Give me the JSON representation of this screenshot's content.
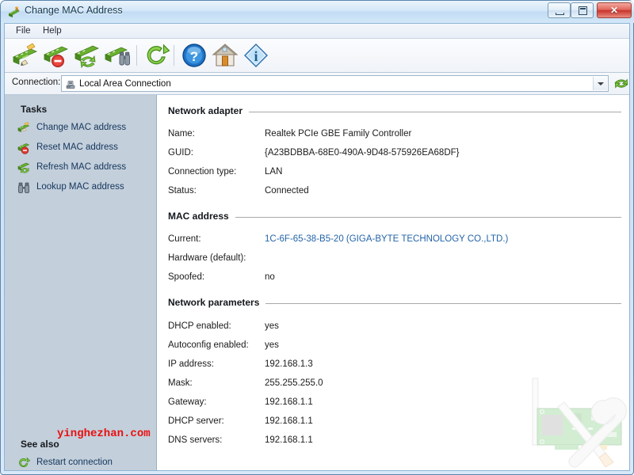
{
  "window": {
    "title": "Change MAC Address",
    "icon": "network-card-icon",
    "buttons": {
      "minimize": "minimize-button",
      "maximize": "maximize-button",
      "close_glyph": "✕"
    }
  },
  "menubar": {
    "items": [
      {
        "label": "File",
        "name": "menu-file"
      },
      {
        "label": "Help",
        "name": "menu-help"
      }
    ]
  },
  "toolbar": {
    "buttons": [
      {
        "name": "change-mac-address-button",
        "icon": "card-pencil-icon",
        "tooltip": "Change MAC address"
      },
      {
        "name": "reset-mac-address-button",
        "icon": "card-stop-icon",
        "tooltip": "Reset MAC address"
      },
      {
        "name": "refresh-mac-address-button",
        "icon": "card-refresh-icon",
        "tooltip": "Refresh MAC address"
      },
      {
        "name": "lookup-mac-address-button",
        "icon": "card-binoculars-icon",
        "tooltip": "Lookup MAC address"
      },
      {
        "name": "restart-connection-button",
        "icon": "green-refresh-icon",
        "tooltip": "Restart connection"
      },
      {
        "name": "help-button",
        "icon": "blue-question-icon",
        "tooltip": "Help"
      },
      {
        "name": "home-button",
        "icon": "home-icon",
        "tooltip": "Home"
      },
      {
        "name": "about-button",
        "icon": "info-diamond-icon",
        "tooltip": "About"
      }
    ]
  },
  "connection": {
    "label": "Connection:",
    "selected": "Local Area Connection",
    "icon": "network-connection-icon",
    "refresh_icon": "refresh-connections-icon",
    "options": [
      "Local Area Connection"
    ]
  },
  "sidebar": {
    "tasks_heading": "Tasks",
    "tasks": [
      {
        "label": "Change MAC address",
        "icon": "card-pencil-icon"
      },
      {
        "label": "Reset MAC address",
        "icon": "card-stop-icon"
      },
      {
        "label": "Refresh MAC address",
        "icon": "card-refresh-icon"
      },
      {
        "label": "Lookup MAC address",
        "icon": "binoculars-icon"
      }
    ],
    "see_also_heading": "See also",
    "see_also": [
      {
        "label": "Restart connection",
        "icon": "green-refresh-icon"
      }
    ],
    "watermark": "yinghezhan.com"
  },
  "content": {
    "sections": [
      {
        "title": "Network adapter",
        "rows": [
          {
            "label": "Name:",
            "value": "Realtek PCIe GBE Family Controller",
            "link": false
          },
          {
            "label": "GUID:",
            "value": "{A23BDBBA-68E0-490A-9D48-575926EA68DF}",
            "link": false
          },
          {
            "label": "Connection type:",
            "value": "LAN",
            "link": false
          },
          {
            "label": "Status:",
            "value": "Connected",
            "link": false
          }
        ]
      },
      {
        "title": "MAC address",
        "rows": [
          {
            "label": "Current:",
            "value": "1C-6F-65-38-B5-20 (GIGA-BYTE TECHNOLOGY CO.,LTD.)",
            "link": true
          },
          {
            "label": "Hardware (default):",
            "value": "",
            "link": false
          },
          {
            "label": "Spoofed:",
            "value": "no",
            "link": false
          }
        ]
      },
      {
        "title": "Network parameters",
        "rows": [
          {
            "label": "DHCP enabled:",
            "value": "yes",
            "link": false
          },
          {
            "label": "Autoconfig enabled:",
            "value": "yes",
            "link": false
          },
          {
            "label": "IP address:",
            "value": "192.168.1.3",
            "link": false
          },
          {
            "label": "Mask:",
            "value": "255.255.255.0",
            "link": false
          },
          {
            "label": "Gateway:",
            "value": "192.168.1.1",
            "link": false
          },
          {
            "label": "DHCP server:",
            "value": "192.168.1.1",
            "link": false
          },
          {
            "label": "DNS servers:",
            "value": "192.168.1.1",
            "link": false
          }
        ]
      }
    ],
    "background_illustration": "network-card-tools-illustration"
  },
  "colors": {
    "title_text": "#16384f",
    "sidebar_bg": "#c3cfdb",
    "link": "#2464a8",
    "watermark": "#e8100f",
    "close_button": "#c8342b"
  }
}
